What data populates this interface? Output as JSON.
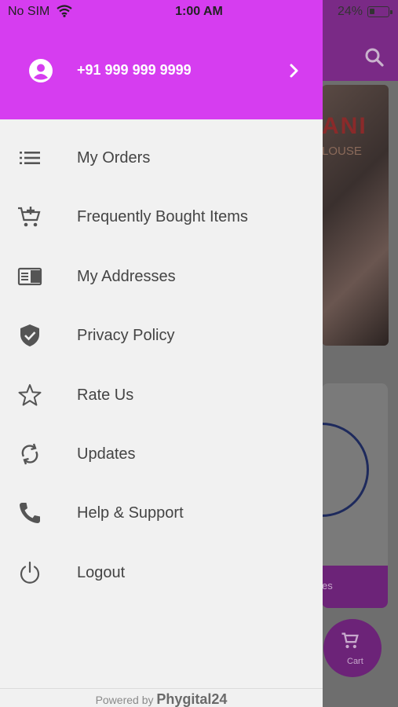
{
  "status_bar": {
    "carrier": "No SIM",
    "time": "1:00 AM",
    "battery": "24%"
  },
  "drawer": {
    "header": {
      "phone": "+91 999 999 9999",
      "avatar_icon": "account-circle-icon",
      "chevron_icon": "chevron-right-icon",
      "background": "#d63df0"
    },
    "items": [
      {
        "label": "My Orders",
        "icon": "list-icon"
      },
      {
        "label": "Frequently Bought Items",
        "icon": "cart-plus-icon"
      },
      {
        "label": "My Addresses",
        "icon": "address-card-icon"
      },
      {
        "label": "Privacy Policy",
        "icon": "shield-check-icon"
      },
      {
        "label": "Rate Us",
        "icon": "star-outline-icon"
      },
      {
        "label": "Updates",
        "icon": "sync-icon"
      },
      {
        "label": "Help & Support",
        "icon": "phone-icon"
      },
      {
        "label": "Logout",
        "icon": "power-icon"
      }
    ],
    "footer": {
      "prefix": "Powered by",
      "brand": "Phygital24"
    }
  },
  "background_app": {
    "banner_title": "ANI",
    "banner_subtitle": "LOUSE",
    "card_button_label": "es",
    "cart_label": "Cart",
    "accent": "#6c2378"
  }
}
